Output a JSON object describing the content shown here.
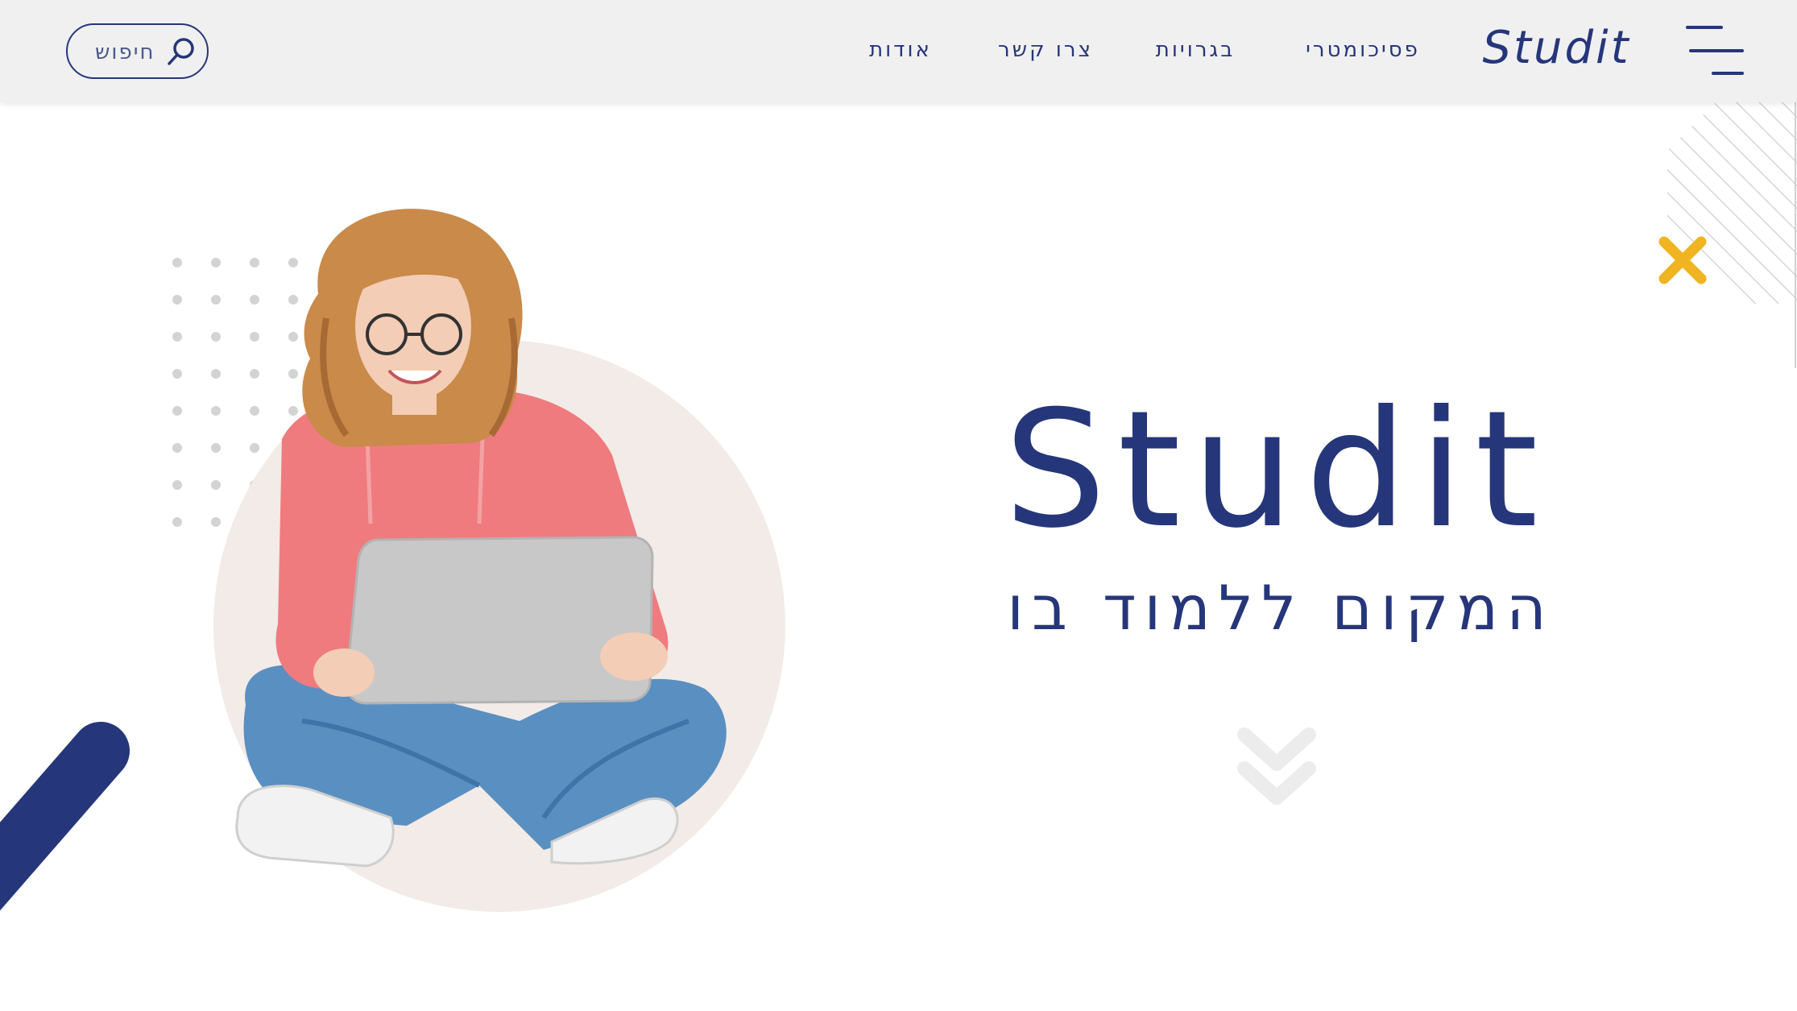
{
  "header": {
    "logo": "Studit",
    "nav": [
      {
        "label": "פסיכומטרי"
      },
      {
        "label": "בגרויות"
      },
      {
        "label": "צרו קשר"
      },
      {
        "label": "אודות"
      }
    ],
    "search_label": "חיפוש"
  },
  "hero": {
    "title": "Studit",
    "tagline": "המקום ללמוד בו"
  },
  "colors": {
    "brand_navy": "#26367a",
    "accent_yellow": "#f0b422",
    "header_bg": "#f0f0f0",
    "circle_bg": "#f2ebe7",
    "hoodie_pink": "#ef7b7f",
    "jeans_blue": "#5a8fc2"
  },
  "icons": [
    "menu-icon",
    "search-icon",
    "chevron-down-icon",
    "close-x-decor-icon"
  ]
}
